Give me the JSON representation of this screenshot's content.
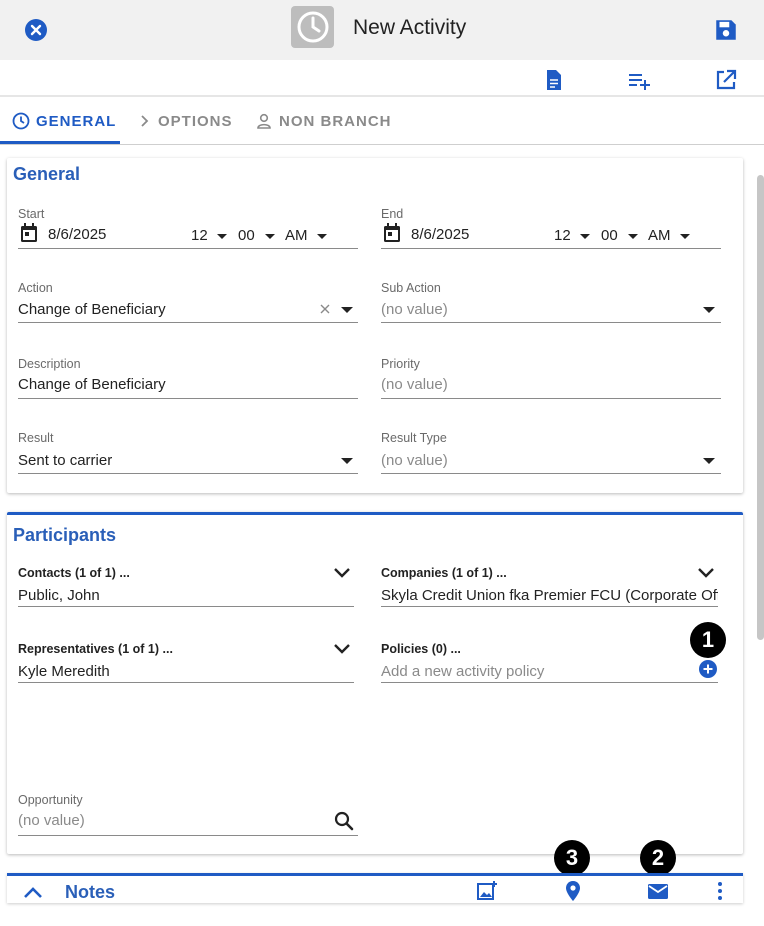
{
  "header": {
    "title": "New Activity"
  },
  "tabs": [
    {
      "label": "GENERAL",
      "icon": "clock-icon"
    },
    {
      "label": "OPTIONS",
      "icon": "chevron-right-icon"
    },
    {
      "label": "NON BRANCH",
      "icon": "person-icon"
    }
  ],
  "general": {
    "title": "General",
    "start": {
      "label": "Start",
      "date": "8/6/2025",
      "hour": "12",
      "minute": "00",
      "ampm": "AM"
    },
    "end": {
      "label": "End",
      "date": "8/6/2025",
      "hour": "12",
      "minute": "00",
      "ampm": "AM"
    },
    "action": {
      "label": "Action",
      "value": "Change of Beneficiary"
    },
    "sub_action": {
      "label": "Sub Action",
      "value": "(no value)"
    },
    "description": {
      "label": "Description",
      "value": "Change of Beneficiary"
    },
    "priority": {
      "label": "Priority",
      "value": "(no value)"
    },
    "result": {
      "label": "Result",
      "value": "Sent to carrier"
    },
    "result_type": {
      "label": "Result Type",
      "value": "(no value)"
    }
  },
  "participants": {
    "title": "Participants",
    "contacts": {
      "label": "Contacts (1 of 1) ...",
      "value": "Public, John"
    },
    "companies": {
      "label": "Companies (1 of 1) ...",
      "value": "Skyla Credit Union fka Premier FCU (Corporate Offi..."
    },
    "representatives": {
      "label": "Representatives (1 of 1) ...",
      "value": "Kyle Meredith"
    },
    "policies": {
      "label": "Policies (0) ...",
      "placeholder": "Add a new activity policy"
    },
    "opportunity": {
      "label": "Opportunity",
      "value": "(no value)"
    }
  },
  "badges": {
    "one": "1",
    "two": "2",
    "three": "3"
  },
  "notes": {
    "title": "Notes"
  },
  "colors": {
    "accent": "#1f5bc4",
    "title": "#2a5fb8"
  }
}
